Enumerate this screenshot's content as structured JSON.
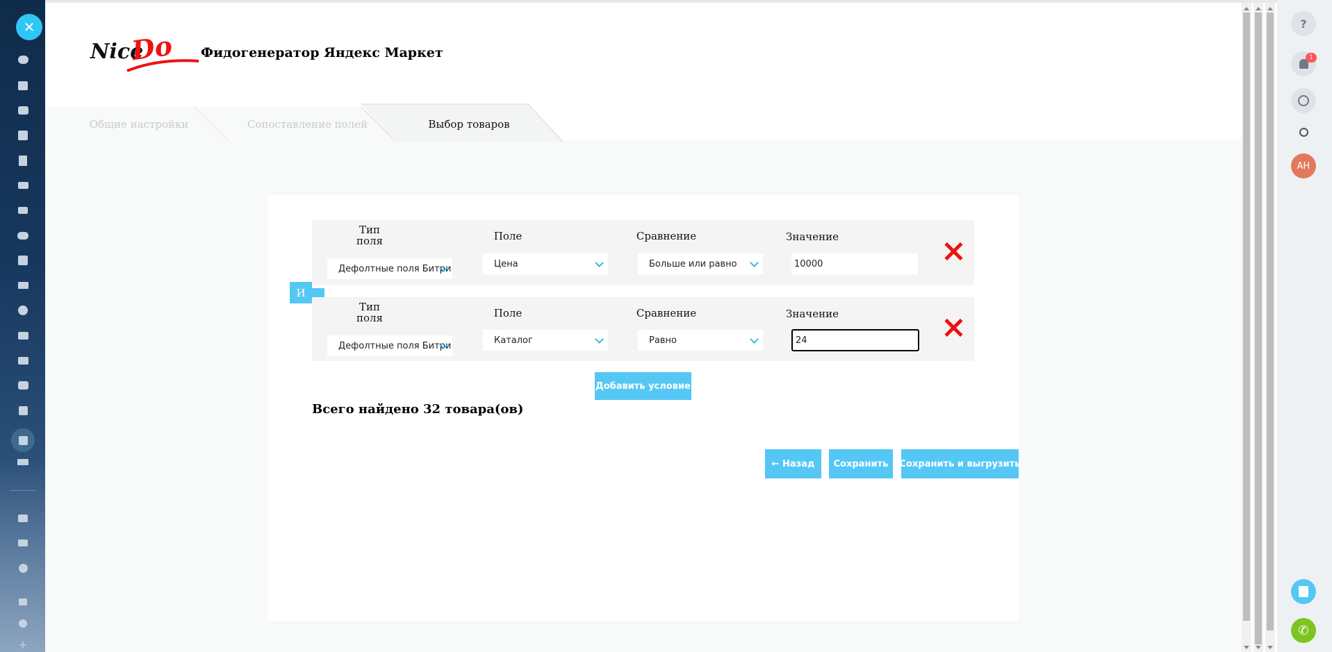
{
  "app": {
    "title": "Фидогенератор Яндекс Маркет",
    "logo_text": "Nice Do"
  },
  "tabs": [
    {
      "label": "Общие настройки",
      "active": false
    },
    {
      "label": "Сопоставление полей",
      "active": false
    },
    {
      "label": "Выбор товаров",
      "active": true
    }
  ],
  "columns": {
    "type_line1": "Тип",
    "type_line2": "поля",
    "field": "Поле",
    "comparison": "Сравнение",
    "value": "Значение"
  },
  "conditions": [
    {
      "type": "Дефолтные поля Битри",
      "field": "Цена",
      "comparison": "Больше или равно",
      "value": "10000"
    },
    {
      "type": "Дефолтные поля Битри",
      "field": "Каталог",
      "comparison": "Равно",
      "value": "24"
    }
  ],
  "logic_connector": "И",
  "add_condition_label": "Добавить условие",
  "total_found": "Всего найдено 32 товара(ов)",
  "buttons": {
    "back": "← Назад",
    "save": "Сохранить",
    "save_export": "Сохранить и выгрузить"
  },
  "right_sidebar": {
    "notifications_count": "1",
    "avatar_initials": "АН"
  },
  "colors": {
    "accent": "#55c7f5",
    "delete": "#ee1111",
    "close_button": "#2fc6f6",
    "avatar": "#e3795c",
    "call_button": "#7cc521",
    "webform_button": "#55c7f5"
  }
}
